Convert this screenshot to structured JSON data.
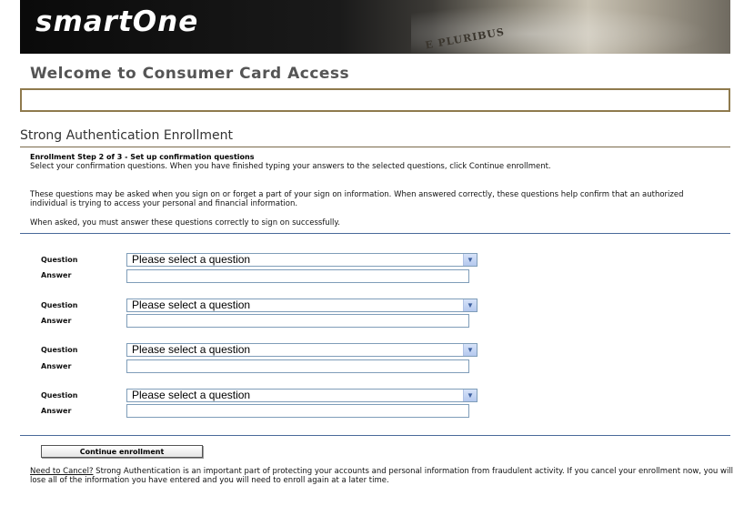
{
  "header": {
    "logo": "smartOne",
    "pluribus": "E PLURIBUS"
  },
  "page": {
    "welcome": "Welcome to Consumer Card Access",
    "section_title": "Strong Authentication Enrollment",
    "step_title": "Enrollment Step 2 of 3 - Set up confirmation questions",
    "instructions": "Select your confirmation questions. When you have finished typing your answers to the selected questions, click Continue enrollment.",
    "info": "These questions may be asked when you sign on or forget a part of your sign on information. When answered correctly, these questions help confirm that an authorized individual is trying to access your personal and financial information.",
    "warning": "When asked, you must answer these questions correctly to sign on successfully."
  },
  "form": {
    "question_label": "Question",
    "answer_label": "Answer",
    "questions": [
      {
        "selected": "Please select a question",
        "answer": ""
      },
      {
        "selected": "Please select a question",
        "answer": ""
      },
      {
        "selected": "Please select a question",
        "answer": ""
      },
      {
        "selected": "Please select a question",
        "answer": ""
      }
    ],
    "continue_label": "Continue enrollment"
  },
  "cancel": {
    "link": "Need to Cancel?",
    "text": " Strong Authentication is an important part of protecting your accounts and personal information from fraudulent activity. If you cancel your enrollment now, you will lose all of the information you have entered and you will need to enroll again at a later time."
  }
}
